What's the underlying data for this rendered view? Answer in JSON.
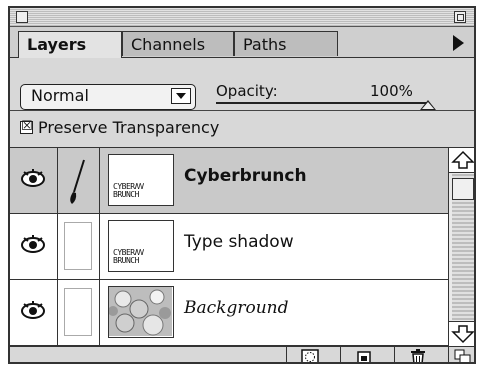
{
  "tabs": {
    "layers": "Layers",
    "channels": "Channels",
    "paths": "Paths"
  },
  "blend_mode": {
    "value": "Normal"
  },
  "opacity": {
    "label": "Opacity:",
    "value": "100%",
    "level": 1.0
  },
  "preserve": {
    "checked": true,
    "check_mark": "☒",
    "label": "Preserve Transparency"
  },
  "layers": [
    {
      "name": "Cyberbrunch",
      "selected": true,
      "thumb_text": "CYBERꟿ\nBRUNCH"
    },
    {
      "name": "Type shadow",
      "selected": false,
      "thumb_text": "CYBERꟿ\nBRUNCH"
    },
    {
      "name": "Background",
      "selected": false,
      "thumb_text": ""
    }
  ],
  "icons": {
    "eye": "eye-icon",
    "brush": "paintbrush-icon",
    "mask": "layer-mask-icon",
    "new_layer": "new-layer-icon",
    "trash": "trash-icon",
    "palette_menu": "palette-menu-arrow-icon"
  },
  "colors": {
    "palette_bg": "#d6d6d6",
    "selected_row": "#c9c9c9"
  }
}
